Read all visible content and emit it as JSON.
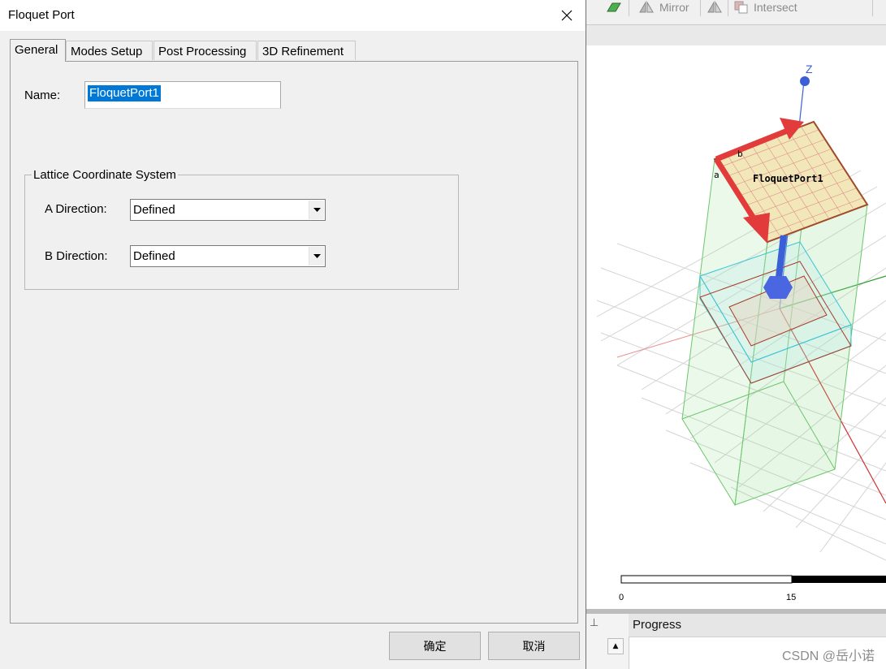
{
  "dialog": {
    "title": "Floquet Port",
    "tabs": [
      {
        "label": "General"
      },
      {
        "label": "Modes Setup"
      },
      {
        "label": "Post Processing"
      },
      {
        "label": "3D Refinement"
      }
    ],
    "name_label": "Name:",
    "name_value": "FloquetPort1",
    "group_title": "Lattice Coordinate System",
    "a_direction_label": "A  Direction:",
    "a_direction_value": "Defined",
    "b_direction_label": "B  Direction:",
    "b_direction_value": "Defined",
    "ok_label": "确定",
    "cancel_label": "取消"
  },
  "toolbar": {
    "mirror_label": "Mirror",
    "intersect_label": "Intersect"
  },
  "viewport": {
    "axis_z_label": "Z",
    "port_label": "FloquetPort1",
    "vector_a_label": "a",
    "vector_b_label": "b",
    "scale_min": "0",
    "scale_mid": "15"
  },
  "progress": {
    "title": "Progress"
  },
  "watermark": "CSDN @岳小诺",
  "colors": {
    "selection": "#0078d7",
    "vector_red": "#e23b3b",
    "axis_blue": "#3a5fd6",
    "box_green": "#7cd47c"
  }
}
